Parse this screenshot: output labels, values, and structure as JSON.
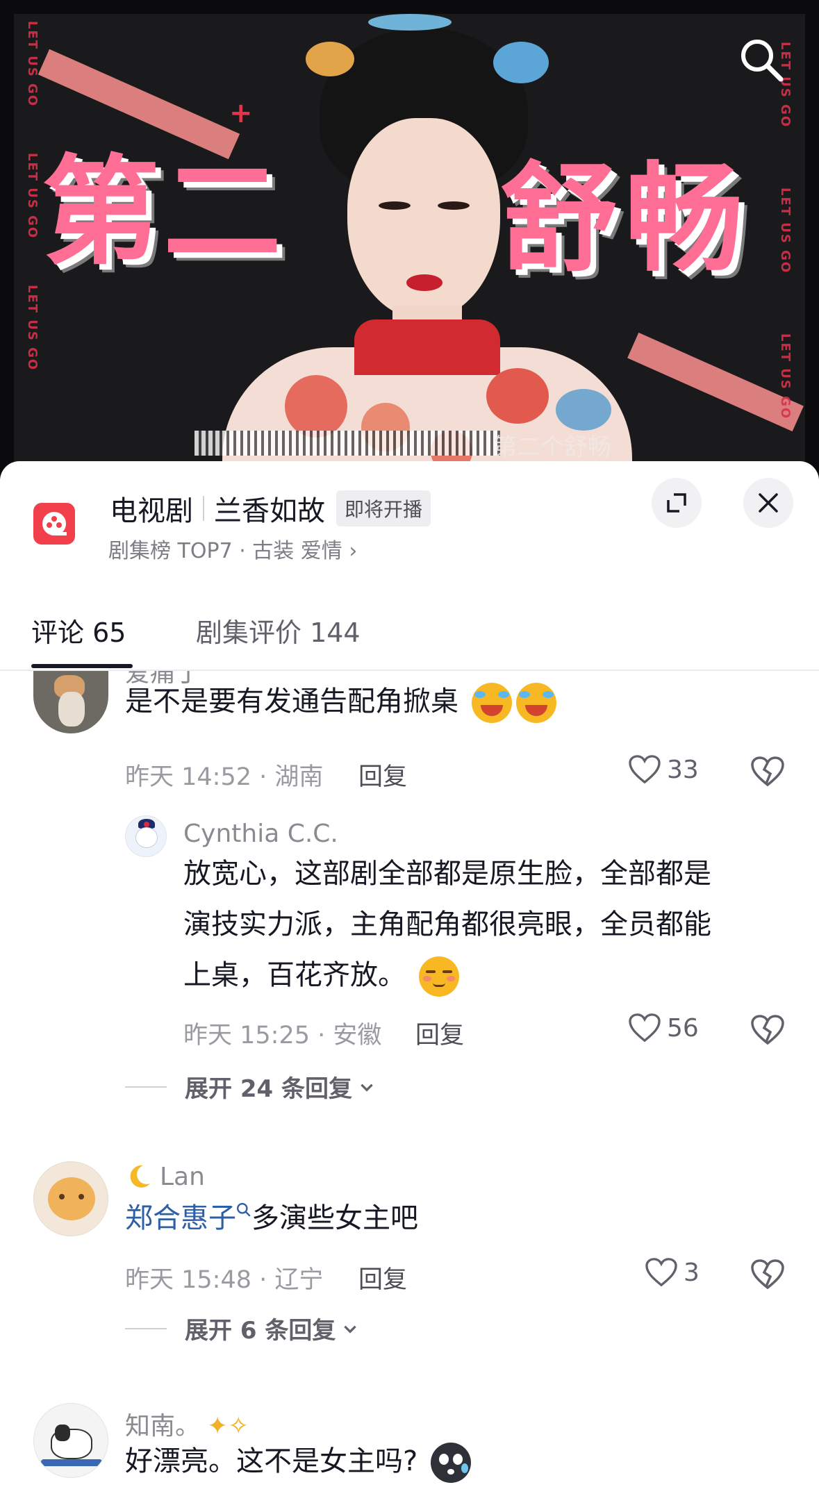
{
  "video": {
    "overlay_chars": [
      "第",
      "二",
      "舒",
      "畅"
    ],
    "side_text": "LET US GO",
    "subtitle": "第二个舒畅"
  },
  "header": {
    "category": "电视剧",
    "title": "兰香如故",
    "badge": "即将开播",
    "subtitle": "剧集榜 TOP7 · 古装 爱情 ›"
  },
  "tabs": [
    {
      "label": "评论 65",
      "active": true
    },
    {
      "label": "剧集评价 144",
      "active": false
    }
  ],
  "comments": [
    {
      "name": "爱痛丁",
      "text": "是不是要有发通告配角掀桌",
      "time": "昨天 14:52 · 湖南",
      "reply_label": "回复",
      "likes": "33",
      "replies": [
        {
          "name": "Cynthia C.C.",
          "lines": [
            "放宽心，这部剧全部都是原生脸，全部都是",
            "演技实力派，主角配角都很亮眼，全员都能",
            "上桌，百花齐放。"
          ],
          "time": "昨天 15:25 · 安徽",
          "reply_label": "回复",
          "likes": "56"
        }
      ],
      "expand": "展开 24 条回复"
    },
    {
      "name": "Lan",
      "mention": "郑合惠子",
      "text": "多演些女主吧",
      "time": "昨天 15:48 · 辽宁",
      "reply_label": "回复",
      "likes": "3",
      "expand": "展开 6 条回复"
    },
    {
      "name": "知南。",
      "text": "好漂亮。这不是女主吗?"
    }
  ],
  "colors": {
    "accent_pink": "#ff6f95",
    "drama_icon_red": "#f1404b",
    "mention_blue": "#2d5ea8"
  }
}
